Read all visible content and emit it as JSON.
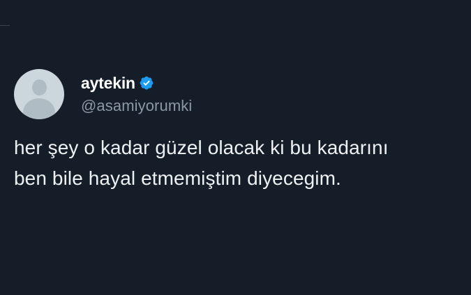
{
  "tweet": {
    "author": {
      "display_name": "aytekin",
      "handle": "@asamiyorumki",
      "verified": true,
      "verified_color": "#1d9bf0",
      "avatar": "default-avatar-icon"
    },
    "text_lines": [
      "her şey o kadar güzel olacak ki bu kadarını",
      "ben bile hayal etmemiştim diyecegim."
    ]
  },
  "theme": {
    "background": "#151d28",
    "text": "#e7e9ea",
    "muted": "#8b98a5"
  }
}
